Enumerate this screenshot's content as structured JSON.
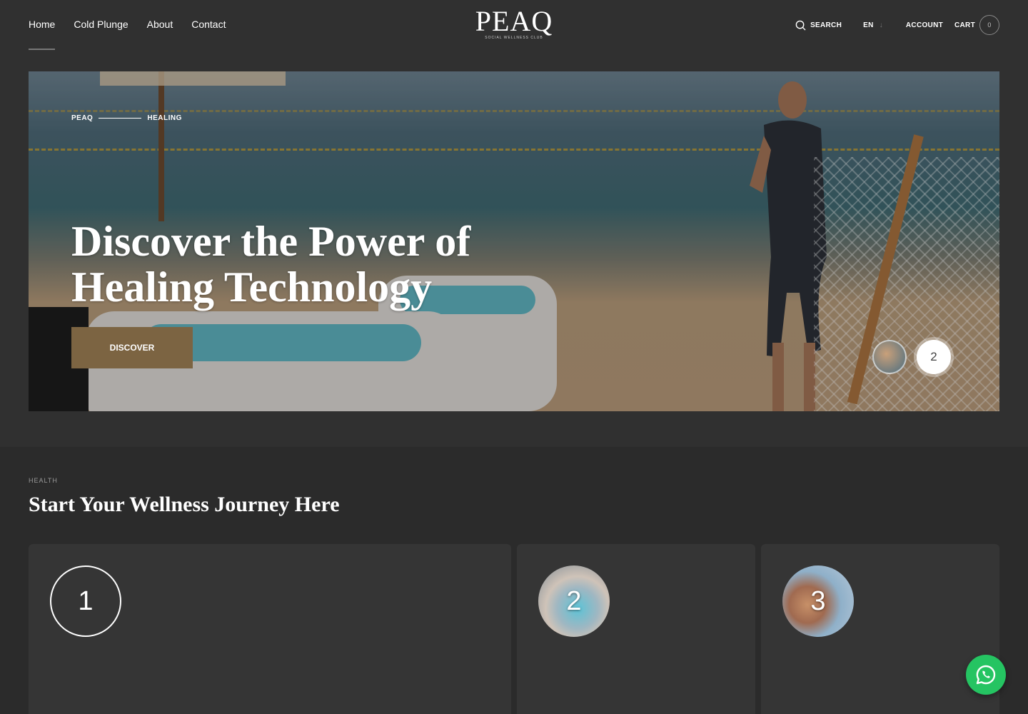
{
  "nav": {
    "items": [
      {
        "label": "Home",
        "active": true
      },
      {
        "label": "Cold Plunge"
      },
      {
        "label": "About"
      },
      {
        "label": "Contact"
      }
    ]
  },
  "logo": {
    "main": "PEAQ",
    "sub": "SOCIAL WELLNESS CLUB"
  },
  "header_right": {
    "search_label": "SEARCH",
    "lang": "EN",
    "account_label": "ACCOUNT",
    "cart_label": "CART",
    "cart_count": "0"
  },
  "hero": {
    "breadcrumb": [
      "PEAQ",
      "HEALING"
    ],
    "title": "Discover the Power of Healing Technology",
    "button_label": "DISCOVER",
    "slide_number": "2"
  },
  "journey": {
    "label": "HEALTH",
    "title": "Start Your Wellness Journey Here",
    "steps": [
      "1",
      "2",
      "3"
    ]
  },
  "colors": {
    "background": "#2b2b2b",
    "header": "#303030",
    "accent_button": "#7c6442",
    "whatsapp": "#25c462"
  }
}
